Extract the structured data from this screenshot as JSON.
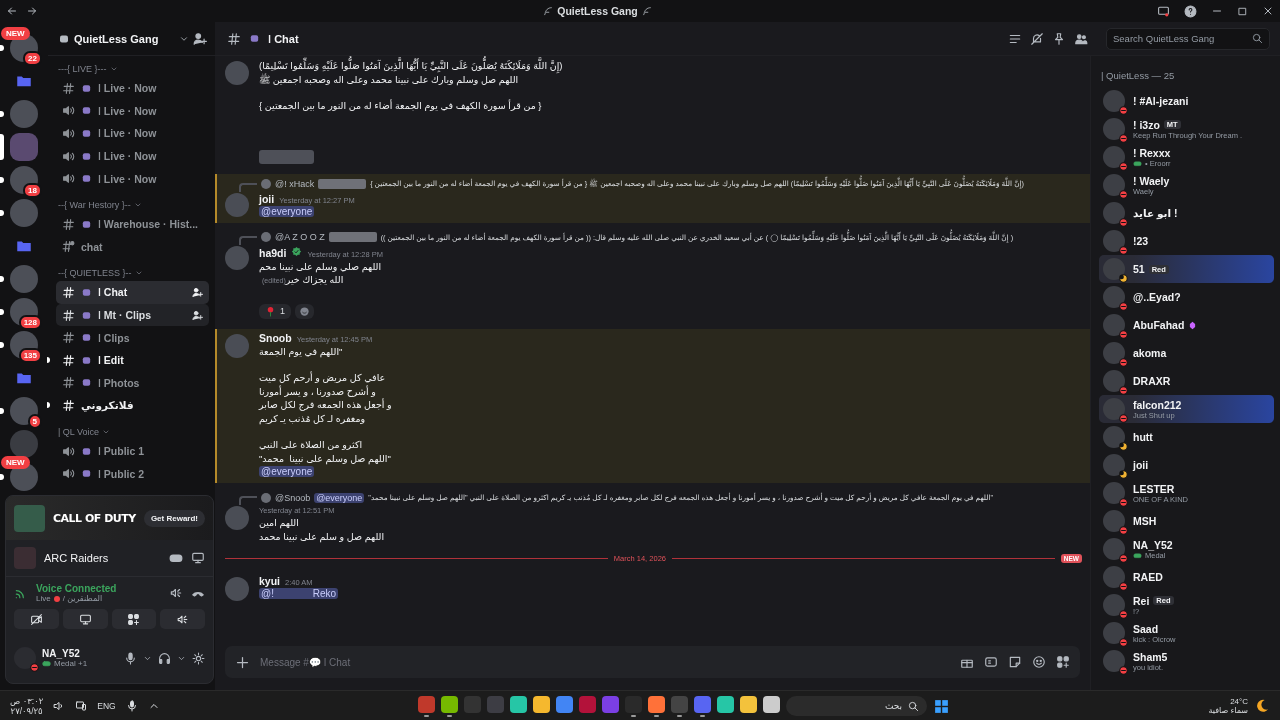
{
  "titlebar": {
    "title": "QuietLess Gang"
  },
  "servers": [
    {
      "kind": "server",
      "badge": "22",
      "pill": "NEW",
      "unread": true,
      "selected": false
    },
    {
      "kind": "folder"
    },
    {
      "kind": "server",
      "unread": true,
      "selected": false
    },
    {
      "kind": "server",
      "unread": false,
      "selected": true
    },
    {
      "kind": "server",
      "badge": "18",
      "unread": true,
      "selected": false
    },
    {
      "kind": "server",
      "unread": true,
      "selected": false
    },
    {
      "kind": "folder"
    },
    {
      "kind": "server",
      "unread": true,
      "selected": false
    },
    {
      "kind": "server",
      "badge": "128",
      "unread": true,
      "selected": false
    },
    {
      "kind": "server",
      "badge": "135",
      "unread": true,
      "selected": false
    },
    {
      "kind": "folder"
    },
    {
      "kind": "server",
      "badge": "5",
      "unread": true,
      "selected": false
    },
    {
      "kind": "server",
      "unread": false,
      "selected": false
    },
    {
      "kind": "server",
      "pill": "NEW",
      "unread": true,
      "selected": false
    }
  ],
  "sidebar": {
    "server_name": "QuietLess Gang",
    "categories": [
      {
        "name": "---{ LIVE }---",
        "channels": [
          {
            "kind": "text",
            "label": "ǀ Live · Now",
            "emoji": true,
            "selected": false,
            "unread": false
          },
          {
            "kind": "voice",
            "label": "ǀ Live · Now",
            "emoji": true,
            "selected": false,
            "unread": false
          },
          {
            "kind": "voice",
            "label": "ǀ Live · Now",
            "emoji": true,
            "selected": false,
            "unread": false
          },
          {
            "kind": "voice",
            "label": "ǀ Live · Now",
            "emoji": true,
            "selected": false,
            "unread": false
          },
          {
            "kind": "voice",
            "label": "ǀ Live · Now",
            "emoji": true,
            "selected": false,
            "unread": false
          }
        ]
      },
      {
        "name": "--{ War Hestory }--",
        "channels": [
          {
            "kind": "text",
            "label": "ǀ Warehouse · Hist...",
            "emoji": true,
            "selected": false,
            "unread": false
          },
          {
            "kind": "thread",
            "label": "chat",
            "emoji": false,
            "selected": false,
            "unread": false
          }
        ]
      },
      {
        "name": "--{ QUIETLESS }--",
        "channels": [
          {
            "kind": "text",
            "label": "ǀ Chat",
            "emoji": true,
            "selected": true,
            "unread": false
          },
          {
            "kind": "text",
            "label": "ǀ Mt · Clips",
            "emoji": true,
            "selected": false,
            "hovered": true,
            "unread": false
          },
          {
            "kind": "text",
            "label": "ǀ Clips",
            "emoji": true,
            "selected": false,
            "unread": false
          },
          {
            "kind": "text",
            "label": "ǀ Edit",
            "emoji": true,
            "selected": false,
            "unread": true
          },
          {
            "kind": "text",
            "label": "ǀ Photos",
            "emoji": true,
            "selected": false,
            "unread": false
          },
          {
            "kind": "text",
            "label": "فلاتكروني",
            "emoji": false,
            "selected": false,
            "unread": true
          }
        ]
      },
      {
        "name": "| QL Voice",
        "channels": [
          {
            "kind": "voice",
            "label": "ǀ Public 1",
            "emoji": true,
            "selected": false,
            "unread": false
          },
          {
            "kind": "voice",
            "label": "ǀ Public 2",
            "emoji": true,
            "selected": false,
            "unread": false
          }
        ]
      }
    ]
  },
  "panel": {
    "promo": {
      "title": "CALL OF DUTY",
      "button": "Get Reward!"
    },
    "activity": "ARC Raiders",
    "voice": {
      "status": "Voice Connected",
      "channel": "Live",
      "server": "/ المطنقرين"
    },
    "user": {
      "name": "NA_Y52",
      "status": "Medal +1"
    }
  },
  "header": {
    "channel": "ǀ Chat",
    "search": {
      "placeholder": "Search QuietLess Gang"
    }
  },
  "messages": [
    {
      "kind": "message",
      "highlighted": false,
      "paragraphs": [
        [
          "(إِنَّ اللَّهَ وَمَلَائِكَتَهُ يُصَلُّونَ عَلَى النَّبِيِّ يَا أَيُّهَا الَّذِينَ آمَنُوا صَلُّوا عَلَيْهِ وَسَلِّمُوا تَسْلِيمًا)",
          "اللهم صل وسلم وبارك على نبينا محمد وعلى اله وصحبه اجمعين ﷺ"
        ],
        [
          "{ من قرأ سورة الكهف في يوم الجمعة أضاء له من النور ما بين الجمعتين }"
        ]
      ],
      "redacted_block": true
    },
    {
      "kind": "message",
      "highlighted": true,
      "reply": {
        "author": "@! xHack",
        "redacted": true,
        "text": "(إِنَّ اللَّهَ وَمَلَائِكَتَهُ يُصَلُّونَ عَلَى النَّبِيِّ يَا أَيُّهَا الَّذِينَ آمَنُوا صَلُّوا عَلَيْهِ وَسَلِّمُوا تَسْلِيمًا) اللهم صل وسلم وبارك على نبينا محمد وعلى اله وصحبه اجمعين ﷺ { من قرأ سورة الكهف في يوم الجمعة أضاء له من النور ما بين الجمعتين }"
      },
      "author": "joii",
      "time": "Yesterday at 12:27 PM",
      "mention": "@everyone"
    },
    {
      "kind": "message",
      "highlighted": false,
      "reply": {
        "author": "@A Z O O Z",
        "redacted": true,
        "text": "( إِنَّ اللَّهَ وَمَلَائِكَتَهُ يُصَلُّونَ عَلَى النَّبِيِّ يَا أَيُّهَا الَّذِينَ آمَنُوا صَلُّوا عَلَيْهِ وَسَلِّمُوا تَسْلِيمًا ◯ ) عن أبي سعيد الخدري عن النبي صلى الله عليه وسلم قال: (( من قرأ سورة الكهف يوم الجمعة أضاء له من النور ما بين الجمعتين ))"
      },
      "author": "ha9di",
      "verified": true,
      "time": "Yesterday at 12:28 PM",
      "paragraphs": [
        [
          "اللهم صلي وسلم على نبينا محم",
          "الله يجزاك خير"
        ]
      ],
      "edited": "(edited)",
      "reactions": [
        {
          "count": "1"
        }
      ]
    },
    {
      "kind": "message",
      "highlighted": true,
      "author": "Snoob",
      "time": "Yesterday at 12:45 PM",
      "paragraphs": [
        [
          "\"اللهم في يوم الجمعة"
        ],
        [
          "عافي كل مريض و أرحم كل ميت",
          "و أشرح صدورنا ، و يسر أمورنا",
          "و أجعل هذه الجمعه فرج لكل صابر",
          "ومغفره لـ كل مُذنب يـ كريم"
        ],
        [
          "اكثرو من الصلاة على النبي",
          "\"اللهم صل وسلم على نبينا  محمد\""
        ]
      ],
      "mention": "@everyone"
    },
    {
      "kind": "message",
      "highlighted": false,
      "reply": {
        "author": "@Snoob",
        "mention": "@everyone",
        "text": "\"اللهم في يوم الجمعة  عافي كل مريض و أرحم كل ميت و أشرح صدورنا ، و يسر أمورنا و أجعل هذه الجمعه فرج لكل صابر ومغفره لـ كل مُذنب يـ كريم  اكثرو من الصلاة على النبي \"اللهم صل وسلم على نبينا  محمد\""
      },
      "time": "Yesterday at 12:51 PM",
      "paragraphs": [
        [
          "اللهم امين",
          "اللهم صل و سلم على نبينا محمد"
        ]
      ]
    },
    {
      "kind": "divider",
      "date": "March 14, 2026",
      "badge": "NEW"
    },
    {
      "kind": "message",
      "highlighted": false,
      "author": "kyui",
      "time": "2:40 AM",
      "mention": "@!              Reko"
    }
  ],
  "composer": {
    "placeholder": "Message #💬 ǀ Chat"
  },
  "members": {
    "heading": "| QuietLess — 25",
    "list": [
      {
        "name": "! #Al-jezani",
        "kind": "dnd"
      },
      {
        "name": "! i3zo",
        "tag": "MT",
        "sub": "Keep Run Through Your Dream .",
        "kind": "dnd"
      },
      {
        "name": "! Rexxx",
        "sub": "• Eroorr",
        "game": true,
        "kind": "dnd"
      },
      {
        "name": "! Waely",
        "sub": "Waely",
        "kind": "dnd"
      },
      {
        "name": "! ابو عايد",
        "kind": "dnd"
      },
      {
        "name": "!23",
        "kind": "dnd"
      },
      {
        "name": "51",
        "tag": "Red",
        "kind": "idle",
        "effect": true
      },
      {
        "name": "@..Eyad?",
        "kind": "dnd"
      },
      {
        "name": "AbuFahad",
        "boost": true,
        "kind": "dnd"
      },
      {
        "name": "akoma",
        "kind": "dnd"
      },
      {
        "name": "DRAXR",
        "kind": "dnd"
      },
      {
        "name": "falcon212",
        "sub": "Just Shut up",
        "kind": "dnd",
        "effect": true
      },
      {
        "name": "hutt",
        "kind": "idle"
      },
      {
        "name": "joii",
        "kind": "idle"
      },
      {
        "name": "LESTER",
        "sub": "ONE OF A KIND",
        "kind": "dnd"
      },
      {
        "name": "MSH",
        "kind": "dnd"
      },
      {
        "name": "NA_Y52",
        "sub": "Medal",
        "game": true,
        "kind": "dnd"
      },
      {
        "name": "RAED",
        "kind": "dnd"
      },
      {
        "name": "Rei",
        "tag": "Red",
        "sub": "!?",
        "kind": "dnd"
      },
      {
        "name": "Saad",
        "sub": "kick : Oicrow",
        "kind": "dnd"
      },
      {
        "name": "Sham5",
        "sub": "you idiot.",
        "kind": "dnd"
      }
    ]
  },
  "taskbar": {
    "time": "٠٣:٠٢ ص",
    "date": "٢٧/٠٩/٢٥",
    "language": "ENG",
    "search": "بحث",
    "weather": {
      "temp": "24°C",
      "text": "سماء صافية"
    },
    "apps": [
      {
        "color": "#c0392b",
        "running": true
      },
      {
        "color": "#76b900",
        "running": true
      },
      {
        "color": "#333333",
        "running": false
      },
      {
        "color": "#3d3d44",
        "running": false
      },
      {
        "color": "#26c6a6",
        "running": false
      },
      {
        "color": "#f5b82e",
        "running": false
      },
      {
        "color": "#4285f4",
        "running": false
      },
      {
        "color": "#b3123a",
        "running": false
      },
      {
        "color": "#7b3fe4",
        "running": false
      },
      {
        "color": "#2a2a2a",
        "running": true
      },
      {
        "color": "#ff7139",
        "running": true
      },
      {
        "color": "#444444",
        "running": true
      },
      {
        "color": "#5865f2",
        "running": true
      },
      {
        "color": "#26c6a6",
        "running": false
      },
      {
        "color": "#f3c23c",
        "running": false
      },
      {
        "color": "#cccccc",
        "running": false
      }
    ]
  }
}
